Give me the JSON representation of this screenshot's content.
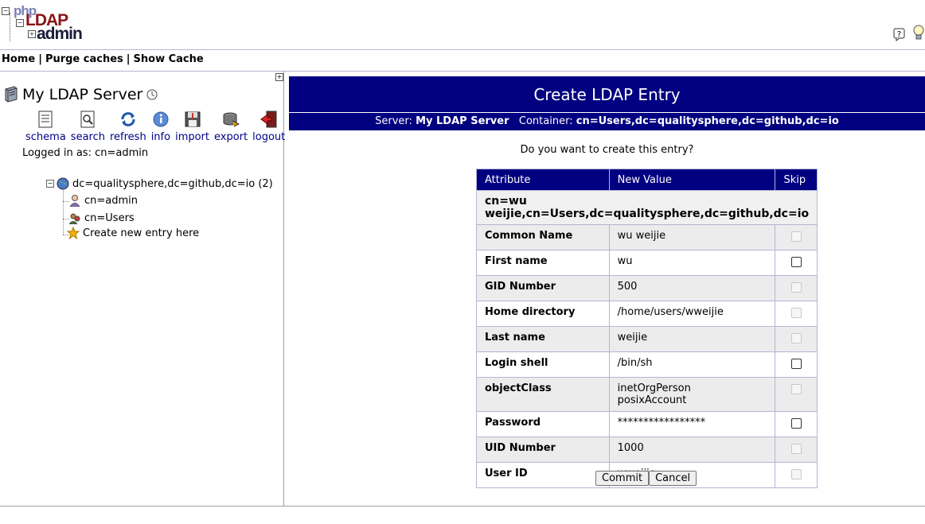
{
  "logo": {
    "php": "php",
    "ldap": "LDAP",
    "admin": "admin"
  },
  "menu": {
    "home": "Home",
    "purge": "Purge caches",
    "show_cache": "Show Cache",
    "separator": "|"
  },
  "left": {
    "server_name": "My LDAP Server",
    "toolbar": [
      {
        "label": "schema",
        "icon": "schema-icon"
      },
      {
        "label": "search",
        "icon": "search-icon"
      },
      {
        "label": "refresh",
        "icon": "refresh-icon"
      },
      {
        "label": "info",
        "icon": "info-icon"
      },
      {
        "label": "import",
        "icon": "import-icon"
      },
      {
        "label": "export",
        "icon": "export-icon"
      },
      {
        "label": "logout",
        "icon": "logout-icon"
      }
    ],
    "logged_in": "Logged in as: cn=admin",
    "tree": {
      "root": "dc=qualitysphere,dc=github,dc=io (2)",
      "children": [
        "cn=admin",
        "cn=Users"
      ],
      "create": "Create new entry here"
    }
  },
  "main": {
    "title": "Create LDAP Entry",
    "server_label": "Server:",
    "server_value": "My LDAP Server",
    "container_label": "Container:",
    "container_value": "cn=Users,dc=qualitysphere,dc=github,dc=io",
    "question": "Do you want to create this entry?",
    "table": {
      "headers": [
        "Attribute",
        "New Value",
        "Skip"
      ],
      "dn": "cn=wu weijie,cn=Users,dc=qualitysphere,dc=github,dc=io",
      "rows": [
        {
          "attribute": "Common Name",
          "value": "wu weijie",
          "skip_enabled": false
        },
        {
          "attribute": "First name",
          "value": "wu",
          "skip_enabled": true
        },
        {
          "attribute": "GID Number",
          "value": "500",
          "skip_enabled": false
        },
        {
          "attribute": "Home directory",
          "value": "/home/users/wweijie",
          "skip_enabled": false
        },
        {
          "attribute": "Last name",
          "value": "weijie",
          "skip_enabled": false
        },
        {
          "attribute": "Login shell",
          "value": "/bin/sh",
          "skip_enabled": true
        },
        {
          "attribute": "objectClass",
          "value": "inetOrgPerson",
          "value2": "posixAccount",
          "skip_enabled": false
        },
        {
          "attribute": "Password",
          "value": "*****************",
          "skip_enabled": true
        },
        {
          "attribute": "UID Number",
          "value": "1000",
          "skip_enabled": false
        },
        {
          "attribute": "User ID",
          "value": "wweijie",
          "skip_enabled": false
        }
      ]
    },
    "commit_label": "Commit",
    "cancel_label": "Cancel"
  }
}
